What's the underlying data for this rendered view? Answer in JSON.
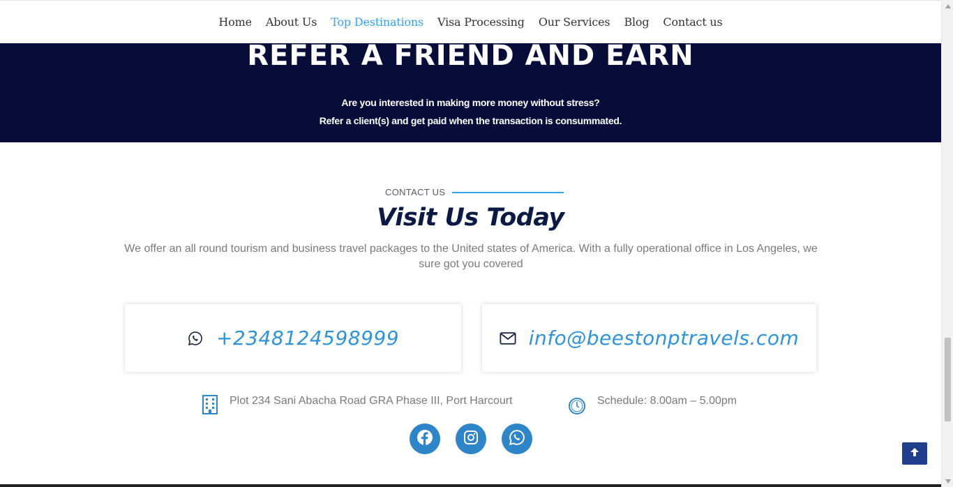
{
  "nav": {
    "items": [
      {
        "label": "Home",
        "active": false
      },
      {
        "label": "About Us",
        "active": false
      },
      {
        "label": "Top Destinations",
        "active": true
      },
      {
        "label": "Visa Processing",
        "active": false
      },
      {
        "label": "Our Services",
        "active": false
      },
      {
        "label": "Blog",
        "active": false
      },
      {
        "label": "Contact us",
        "active": false
      }
    ],
    "active_color": "#2ea3f2"
  },
  "banner": {
    "title": "REFER A FRIEND AND EARN",
    "line1": "Are you interested in making more money without stress?",
    "line2": "Refer a client(s) and get paid when the transaction is consummated.",
    "background": "#050d38"
  },
  "contact": {
    "eyebrow": "CONTACT US",
    "heading": "Visit Us Today",
    "description": "We offer an all round tourism and business travel packages to the United states of America. With a fully operational office in Los Angeles, we sure got you covered",
    "phone": {
      "icon": "whatsapp-icon",
      "text": "+2348124598999"
    },
    "email": {
      "icon": "envelope-icon",
      "text": "info@beestonptravels.com"
    },
    "address": {
      "icon": "building-icon",
      "text": "Plot 234 Sani Abacha Road GRA Phase III, Port Harcourt"
    },
    "schedule": {
      "icon": "clock-icon",
      "text": "Schedule: 8.00am – 5.00pm"
    },
    "accent": "#2e93d8"
  },
  "socials": [
    {
      "name": "facebook",
      "icon": "facebook-icon"
    },
    {
      "name": "instagram",
      "icon": "instagram-icon"
    },
    {
      "name": "whatsapp",
      "icon": "whatsapp-icon"
    }
  ],
  "scroll_top": {
    "icon": "arrow-up-icon"
  }
}
